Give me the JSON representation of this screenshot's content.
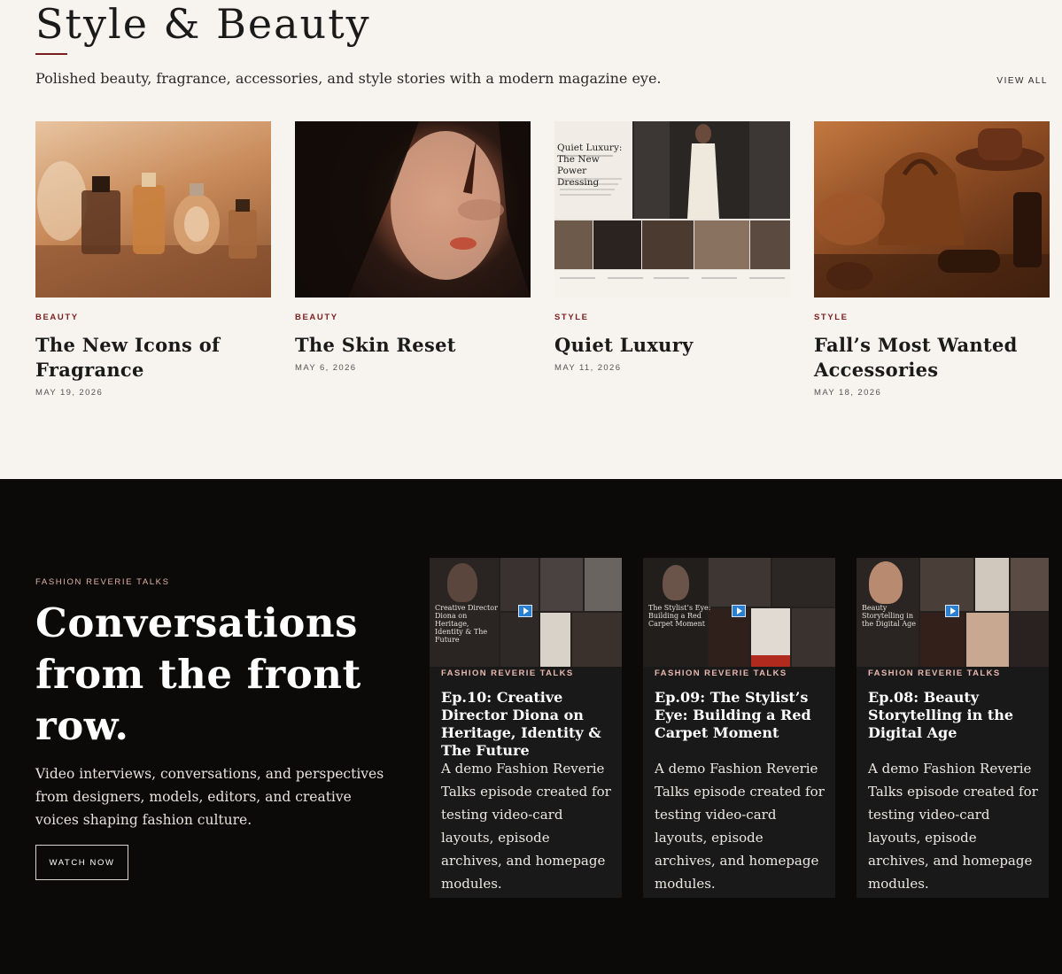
{
  "section": {
    "title": "Style & Beauty",
    "subtitle": "Polished beauty, fragrance, accessories, and style stories with a modern magazine eye.",
    "view_all": "VIEW ALL"
  },
  "articles": [
    {
      "category": "BEAUTY",
      "title": "The New Icons of Fragrance",
      "date": "MAY 19, 2026"
    },
    {
      "category": "BEAUTY",
      "title": "The Skin Reset",
      "date": "MAY 6, 2026"
    },
    {
      "category": "STYLE",
      "title": "Quiet Luxury",
      "date": "MAY 11, 2026"
    },
    {
      "category": "STYLE",
      "title": "Fall’s Most Wanted Accessories",
      "date": "MAY 18, 2026"
    }
  ],
  "thumb3": {
    "title": "Quiet Luxury: The New Power Dressing"
  },
  "talks": {
    "kicker": "FASHION REVERIE TALKS",
    "heading": "Conversations from the front row.",
    "description": "Video interviews, conversations, and perspectives from designers, models, editors, and creative voices shaping fashion culture.",
    "button": "WATCH NOW",
    "episodes": [
      {
        "kicker": "FASHION REVERIE TALKS",
        "title": "Ep.10: Creative Director Diona on Heritage, Identity & The Future",
        "thumb_title": "Creative Director Diona on Heritage, Identity & The Future",
        "description": "A demo Fashion Reverie Talks episode created for testing video-card layouts, episode archives, and homepage modules."
      },
      {
        "kicker": "FASHION REVERIE TALKS",
        "title": "Ep.09: The Stylist’s Eye: Building a Red Carpet Moment",
        "thumb_title": "The Stylist’s Eye: Building a Red Carpet Moment",
        "description": "A demo Fashion Reverie Talks episode created for testing video-card layouts, episode archives, and homepage modules."
      },
      {
        "kicker": "FASHION REVERIE TALKS",
        "title": "Ep.08: Beauty Storytelling in the Digital Age",
        "thumb_title": "Beauty Storytelling in the Digital Age",
        "description": "A demo Fashion Reverie Talks episode created for testing video-card layouts, episode archives, and homepage modules."
      }
    ]
  },
  "colors": {
    "accent": "#7a1f1f",
    "background_light": "#f7f3ee",
    "background_dark": "#0b0a09",
    "card_dark": "#1a1919",
    "play_button": "#2b7fd0"
  }
}
